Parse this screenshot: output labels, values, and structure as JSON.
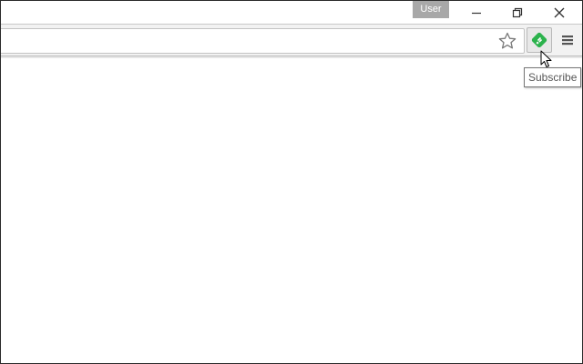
{
  "titlebar": {
    "user_label": "User",
    "buttons": {
      "minimize_icon": "minimize-icon",
      "restore_icon": "restore-icon",
      "close_icon": "close-icon"
    }
  },
  "toolbar": {
    "bookmark_icon": "star-icon",
    "extension_icon": "feedly-icon",
    "extension_color": "#2bb24c",
    "menu_icon": "hamburger-menu-icon"
  },
  "tooltip": {
    "text": "Subscribe"
  }
}
